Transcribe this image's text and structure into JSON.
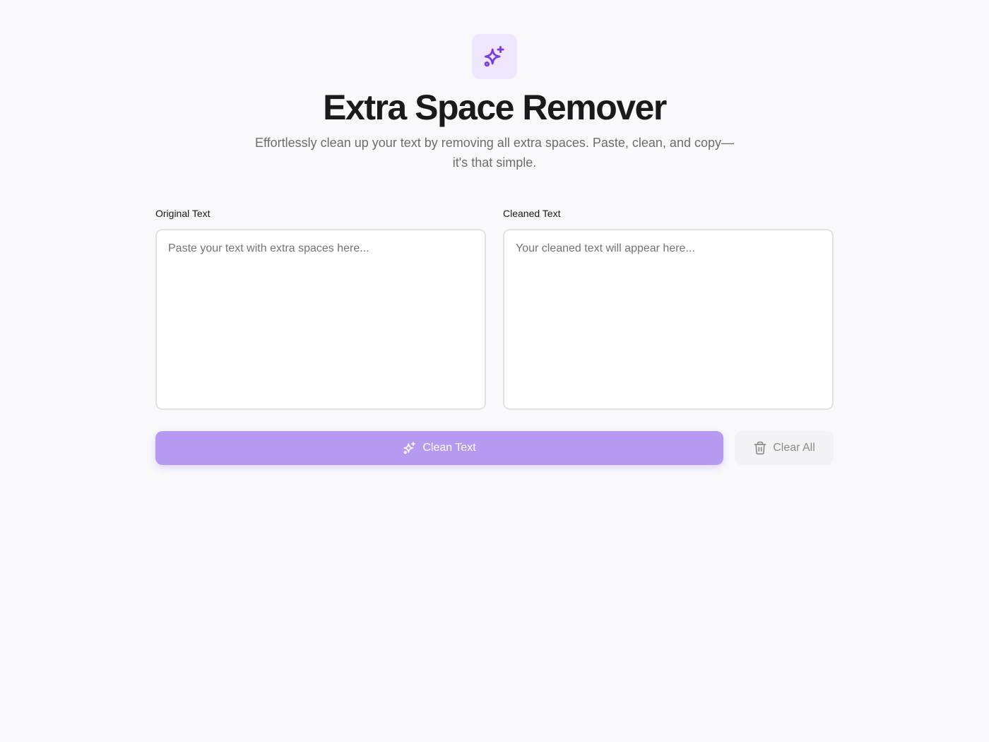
{
  "header": {
    "logo_icon": "sparkles-icon",
    "title": "Extra Space Remover",
    "subtitle": "Effortlessly clean up your text by removing all extra spaces. Paste, clean, and copy—it's that simple."
  },
  "editor": {
    "original_label": "Original Text",
    "original_value": "",
    "original_placeholder": "Paste your text with extra spaces here...",
    "cleaned_label": "Cleaned Text",
    "cleaned_value": "",
    "cleaned_placeholder": "Your cleaned text will appear here..."
  },
  "actions": {
    "clean_label": "Clean Text",
    "clean_icon": "sparkles-icon",
    "clear_label": "Clear All",
    "clear_icon": "trash-icon"
  },
  "colors": {
    "accent": "#7c3aed",
    "accent_light": "#ede6fc",
    "clean_button": "#b69af1",
    "background": "#f9f9fb"
  }
}
